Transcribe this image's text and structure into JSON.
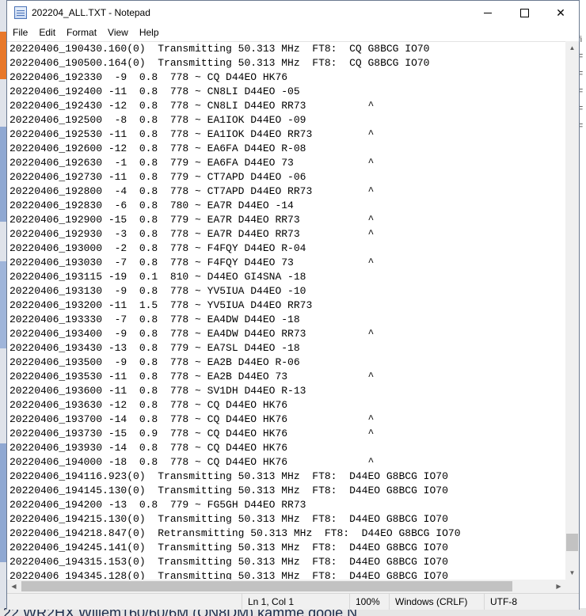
{
  "background": {
    "bottom_text": "22   WR2HX  Willem160/60/6M (ON8DM) kamme gooie N",
    "right_glyphs": [
      "fi",
      "F",
      "F",
      "F",
      "F",
      "F"
    ]
  },
  "window": {
    "title": "202204_ALL.TXT - Notepad"
  },
  "menu": [
    "File",
    "Edit",
    "Format",
    "View",
    "Help"
  ],
  "lines": [
    "20220406_190430.160(0)  Transmitting 50.313 MHz  FT8:  CQ G8BCG IO70",
    "20220406_190500.164(0)  Transmitting 50.313 MHz  FT8:  CQ G8BCG IO70",
    "20220406_192330  -9  0.8  778 ~ CQ D44EO HK76",
    "20220406_192400 -11  0.8  778 ~ CN8LI D44EO -05",
    "20220406_192430 -12  0.8  778 ~ CN8LI D44EO RR73          ^",
    "20220406_192500  -8  0.8  778 ~ EA1IOK D44EO -09",
    "20220406_192530 -11  0.8  778 ~ EA1IOK D44EO RR73         ^",
    "20220406_192600 -12  0.8  778 ~ EA6FA D44EO R-08",
    "20220406_192630  -1  0.8  779 ~ EA6FA D44EO 73            ^",
    "20220406_192730 -11  0.8  779 ~ CT7APD D44EO -06",
    "20220406_192800  -4  0.8  778 ~ CT7APD D44EO RR73         ^",
    "20220406_192830  -6  0.8  780 ~ EA7R D44EO -14",
    "20220406_192900 -15  0.8  779 ~ EA7R D44EO RR73           ^",
    "20220406_192930  -3  0.8  778 ~ EA7R D44EO RR73           ^",
    "20220406_193000  -2  0.8  778 ~ F4FQY D44EO R-04",
    "20220406_193030  -7  0.8  778 ~ F4FQY D44EO 73            ^",
    "20220406_193115 -19  0.1  810 ~ D44EO GI4SNA -18",
    "20220406_193130  -9  0.8  778 ~ YV5IUA D44EO -10",
    "20220406_193200 -11  1.5  778 ~ YV5IUA D44EO RR73",
    "20220406_193330  -7  0.8  778 ~ EA4DW D44EO -18",
    "20220406_193400  -9  0.8  778 ~ EA4DW D44EO RR73          ^",
    "20220406_193430 -13  0.8  779 ~ EA7SL D44EO -18",
    "20220406_193500  -9  0.8  778 ~ EA2B D44EO R-06",
    "20220406_193530 -11  0.8  778 ~ EA2B D44EO 73             ^",
    "20220406_193600 -11  0.8  778 ~ SV1DH D44EO R-13",
    "20220406_193630 -12  0.8  778 ~ CQ D44EO HK76",
    "20220406_193700 -14  0.8  778 ~ CQ D44EO HK76             ^",
    "20220406_193730 -15  0.9  778 ~ CQ D44EO HK76             ^",
    "20220406_193930 -14  0.8  778 ~ CQ D44EO HK76",
    "20220406_194000 -18  0.8  778 ~ CQ D44EO HK76             ^",
    "20220406_194116.923(0)  Transmitting 50.313 MHz  FT8:  D44EO G8BCG IO70",
    "20220406_194145.130(0)  Transmitting 50.313 MHz  FT8:  D44EO G8BCG IO70",
    "20220406_194200 -13  0.8  779 ~ FG5GH D44EO RR73",
    "20220406_194215.130(0)  Transmitting 50.313 MHz  FT8:  D44EO G8BCG IO70",
    "20220406_194218.847(0)  Retransmitting 50.313 MHz  FT8:  D44EO G8BCG IO70",
    "20220406_194245.141(0)  Transmitting 50.313 MHz  FT8:  D44EO G8BCG IO70",
    "20220406_194315.153(0)  Transmitting 50.313 MHz  FT8:  D44EO G8BCG IO70",
    "20220406_194345.128(0)  Transmitting 50.313 MHz  FT8:  D44EO G8BCG IO70"
  ],
  "status": {
    "position": "Ln 1, Col 1",
    "zoom": "100%",
    "line_ending": "Windows (CRLF)",
    "encoding": "UTF-8"
  },
  "colors": {
    "desktop_accent": "#3a5fa0",
    "bg_orange": "#e8782a"
  }
}
